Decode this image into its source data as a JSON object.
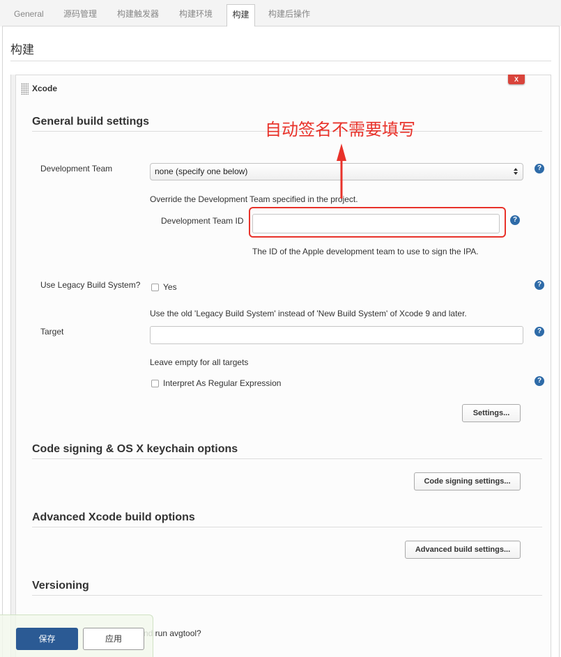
{
  "tabs": [
    {
      "label": "General"
    },
    {
      "label": "源码管理"
    },
    {
      "label": "构建触发器"
    },
    {
      "label": "构建环境"
    },
    {
      "label": "构建",
      "active": true
    },
    {
      "label": "构建后操作"
    }
  ],
  "section": {
    "title": "构建"
  },
  "builder": {
    "title": "Xcode",
    "delete_label": "X",
    "general": {
      "heading": "General build settings",
      "development_team": {
        "label": "Development Team",
        "selected": "none (specify one below)",
        "hint": "Override the Development Team specified in the project."
      },
      "development_team_id": {
        "label": "Development Team ID",
        "value": "",
        "hint": "The ID of the Apple development team to use to sign the IPA."
      },
      "legacy_build": {
        "label": "Use Legacy Build System?",
        "checkbox_label": "Yes",
        "checked": false,
        "hint": "Use the old 'Legacy Build System' instead of 'New Build System' of Xcode 9 and later."
      },
      "target": {
        "label": "Target",
        "value": "",
        "hint": "Leave empty for all targets"
      },
      "regex": {
        "label": "Interpret As Regular Expression",
        "checked": false
      },
      "settings_button": "Settings..."
    },
    "code_signing": {
      "heading": "Code signing & OS X keychain options",
      "button": "Code signing settings..."
    },
    "advanced": {
      "heading": "Advanced Xcode build options",
      "button": "Advanced build settings..."
    },
    "versioning": {
      "heading": "Versioning",
      "visible_label_fragment": "nd run avgtool?"
    }
  },
  "annotation": {
    "text": "自动签名不需要填写"
  },
  "bottom_bar": {
    "save_label": "保存",
    "apply_label": "应用"
  },
  "icons": {
    "help": "help-icon",
    "help_glyph": "?",
    "drag": "drag-handle-icon",
    "select": "up-down-arrows-icon",
    "annotation_arrow": "up-arrow-icon"
  },
  "colors": {
    "annotation_red": "#e8322a",
    "help_blue": "#2e6ba8",
    "save_button": "#2b5a94",
    "delete_red": "#d9443b"
  }
}
